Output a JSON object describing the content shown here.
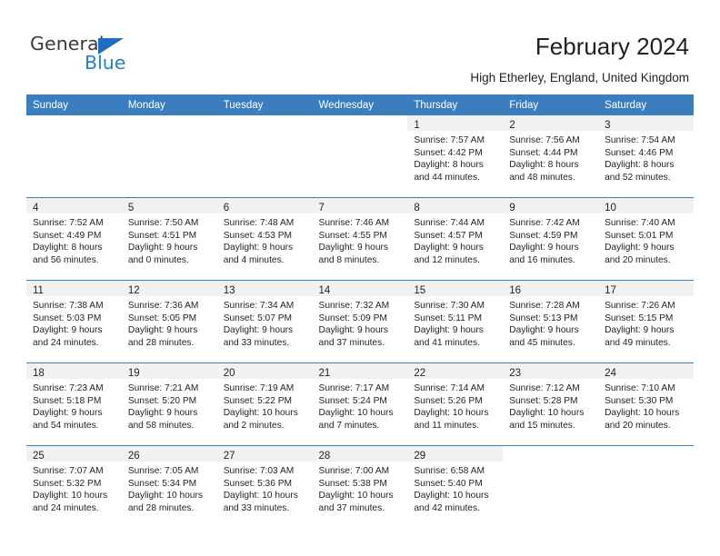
{
  "brand": {
    "name_top": "General",
    "name_bottom": "Blue",
    "triangle_color": "#1b6ec2",
    "blue_color": "#2281c9"
  },
  "header": {
    "title": "February 2024",
    "subtitle": "High Etherley, England, United Kingdom"
  },
  "theme": {
    "header_blue": "#3b7ec0",
    "daynum_band": "#f1f1f1",
    "text": "#231f20"
  },
  "weekday_headers": [
    "Sunday",
    "Monday",
    "Tuesday",
    "Wednesday",
    "Thursday",
    "Friday",
    "Saturday"
  ],
  "labels": {
    "sunrise_prefix": "Sunrise: ",
    "sunset_prefix": "Sunset: ",
    "daylight_prefix": "Daylight: "
  },
  "weeks": [
    [
      {
        "day": "",
        "sunrise": "",
        "sunset": "",
        "daylight": "",
        "blank": true
      },
      {
        "day": "",
        "sunrise": "",
        "sunset": "",
        "daylight": "",
        "blank": true
      },
      {
        "day": "",
        "sunrise": "",
        "sunset": "",
        "daylight": "",
        "blank": true
      },
      {
        "day": "",
        "sunrise": "",
        "sunset": "",
        "daylight": "",
        "blank": true
      },
      {
        "day": "1",
        "sunrise": "Sunrise: 7:57 AM",
        "sunset": "Sunset: 4:42 PM",
        "daylight": "Daylight: 8 hours and 44 minutes."
      },
      {
        "day": "2",
        "sunrise": "Sunrise: 7:56 AM",
        "sunset": "Sunset: 4:44 PM",
        "daylight": "Daylight: 8 hours and 48 minutes."
      },
      {
        "day": "3",
        "sunrise": "Sunrise: 7:54 AM",
        "sunset": "Sunset: 4:46 PM",
        "daylight": "Daylight: 8 hours and 52 minutes."
      }
    ],
    [
      {
        "day": "4",
        "sunrise": "Sunrise: 7:52 AM",
        "sunset": "Sunset: 4:49 PM",
        "daylight": "Daylight: 8 hours and 56 minutes."
      },
      {
        "day": "5",
        "sunrise": "Sunrise: 7:50 AM",
        "sunset": "Sunset: 4:51 PM",
        "daylight": "Daylight: 9 hours and 0 minutes."
      },
      {
        "day": "6",
        "sunrise": "Sunrise: 7:48 AM",
        "sunset": "Sunset: 4:53 PM",
        "daylight": "Daylight: 9 hours and 4 minutes."
      },
      {
        "day": "7",
        "sunrise": "Sunrise: 7:46 AM",
        "sunset": "Sunset: 4:55 PM",
        "daylight": "Daylight: 9 hours and 8 minutes."
      },
      {
        "day": "8",
        "sunrise": "Sunrise: 7:44 AM",
        "sunset": "Sunset: 4:57 PM",
        "daylight": "Daylight: 9 hours and 12 minutes."
      },
      {
        "day": "9",
        "sunrise": "Sunrise: 7:42 AM",
        "sunset": "Sunset: 4:59 PM",
        "daylight": "Daylight: 9 hours and 16 minutes."
      },
      {
        "day": "10",
        "sunrise": "Sunrise: 7:40 AM",
        "sunset": "Sunset: 5:01 PM",
        "daylight": "Daylight: 9 hours and 20 minutes."
      }
    ],
    [
      {
        "day": "11",
        "sunrise": "Sunrise: 7:38 AM",
        "sunset": "Sunset: 5:03 PM",
        "daylight": "Daylight: 9 hours and 24 minutes."
      },
      {
        "day": "12",
        "sunrise": "Sunrise: 7:36 AM",
        "sunset": "Sunset: 5:05 PM",
        "daylight": "Daylight: 9 hours and 28 minutes."
      },
      {
        "day": "13",
        "sunrise": "Sunrise: 7:34 AM",
        "sunset": "Sunset: 5:07 PM",
        "daylight": "Daylight: 9 hours and 33 minutes."
      },
      {
        "day": "14",
        "sunrise": "Sunrise: 7:32 AM",
        "sunset": "Sunset: 5:09 PM",
        "daylight": "Daylight: 9 hours and 37 minutes."
      },
      {
        "day": "15",
        "sunrise": "Sunrise: 7:30 AM",
        "sunset": "Sunset: 5:11 PM",
        "daylight": "Daylight: 9 hours and 41 minutes."
      },
      {
        "day": "16",
        "sunrise": "Sunrise: 7:28 AM",
        "sunset": "Sunset: 5:13 PM",
        "daylight": "Daylight: 9 hours and 45 minutes."
      },
      {
        "day": "17",
        "sunrise": "Sunrise: 7:26 AM",
        "sunset": "Sunset: 5:15 PM",
        "daylight": "Daylight: 9 hours and 49 minutes."
      }
    ],
    [
      {
        "day": "18",
        "sunrise": "Sunrise: 7:23 AM",
        "sunset": "Sunset: 5:18 PM",
        "daylight": "Daylight: 9 hours and 54 minutes."
      },
      {
        "day": "19",
        "sunrise": "Sunrise: 7:21 AM",
        "sunset": "Sunset: 5:20 PM",
        "daylight": "Daylight: 9 hours and 58 minutes."
      },
      {
        "day": "20",
        "sunrise": "Sunrise: 7:19 AM",
        "sunset": "Sunset: 5:22 PM",
        "daylight": "Daylight: 10 hours and 2 minutes."
      },
      {
        "day": "21",
        "sunrise": "Sunrise: 7:17 AM",
        "sunset": "Sunset: 5:24 PM",
        "daylight": "Daylight: 10 hours and 7 minutes."
      },
      {
        "day": "22",
        "sunrise": "Sunrise: 7:14 AM",
        "sunset": "Sunset: 5:26 PM",
        "daylight": "Daylight: 10 hours and 11 minutes."
      },
      {
        "day": "23",
        "sunrise": "Sunrise: 7:12 AM",
        "sunset": "Sunset: 5:28 PM",
        "daylight": "Daylight: 10 hours and 15 minutes."
      },
      {
        "day": "24",
        "sunrise": "Sunrise: 7:10 AM",
        "sunset": "Sunset: 5:30 PM",
        "daylight": "Daylight: 10 hours and 20 minutes."
      }
    ],
    [
      {
        "day": "25",
        "sunrise": "Sunrise: 7:07 AM",
        "sunset": "Sunset: 5:32 PM",
        "daylight": "Daylight: 10 hours and 24 minutes."
      },
      {
        "day": "26",
        "sunrise": "Sunrise: 7:05 AM",
        "sunset": "Sunset: 5:34 PM",
        "daylight": "Daylight: 10 hours and 28 minutes."
      },
      {
        "day": "27",
        "sunrise": "Sunrise: 7:03 AM",
        "sunset": "Sunset: 5:36 PM",
        "daylight": "Daylight: 10 hours and 33 minutes."
      },
      {
        "day": "28",
        "sunrise": "Sunrise: 7:00 AM",
        "sunset": "Sunset: 5:38 PM",
        "daylight": "Daylight: 10 hours and 37 minutes."
      },
      {
        "day": "29",
        "sunrise": "Sunrise: 6:58 AM",
        "sunset": "Sunset: 5:40 PM",
        "daylight": "Daylight: 10 hours and 42 minutes."
      },
      {
        "day": "",
        "sunrise": "",
        "sunset": "",
        "daylight": "",
        "blank": true
      },
      {
        "day": "",
        "sunrise": "",
        "sunset": "",
        "daylight": "",
        "blank": true
      }
    ]
  ]
}
